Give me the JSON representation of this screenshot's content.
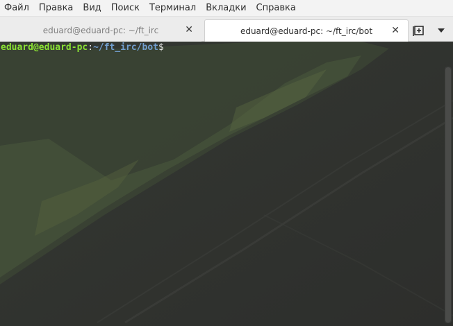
{
  "menubar": {
    "items": [
      "Файл",
      "Правка",
      "Вид",
      "Поиск",
      "Терминал",
      "Вкладки",
      "Справка"
    ]
  },
  "tabs": [
    {
      "label": "eduard@eduard-pc: ~/ft_irc",
      "active": false,
      "close": "✕"
    },
    {
      "label": "eduard@eduard-pc: ~/ft_irc/bot",
      "active": true,
      "close": "✕"
    }
  ],
  "toolbar": {
    "new_tab_icon": "new-tab-icon",
    "menu_icon": "chevron-down-icon"
  },
  "terminal": {
    "prompt_user": "eduard@eduard-pc",
    "prompt_sep": ":",
    "prompt_path": "~/ft_irc/bot",
    "prompt_end": "$"
  },
  "colors": {
    "prompt_user": "#8ae234",
    "prompt_path": "#729fcf",
    "terminal_bg": "#2f302e"
  }
}
